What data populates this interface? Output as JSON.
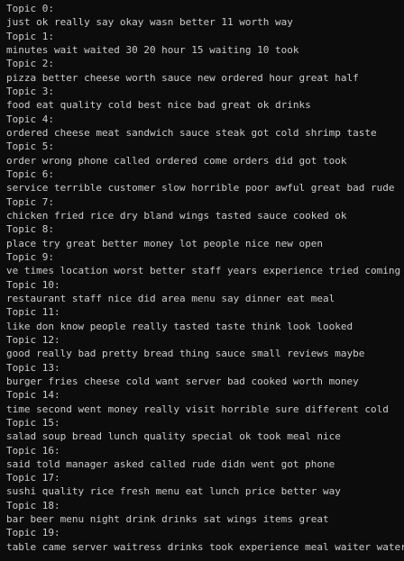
{
  "terminal": {
    "background": "#0c0c0c",
    "foreground": "#cccccc",
    "topics": [
      {
        "header": "Topic 0:",
        "words": "just ok really say okay wasn better 11 worth way"
      },
      {
        "header": "Topic 1:",
        "words": "minutes wait waited 30 20 hour 15 waiting 10 took"
      },
      {
        "header": "Topic 2:",
        "words": "pizza better cheese worth sauce new ordered hour great half"
      },
      {
        "header": "Topic 3:",
        "words": "food eat quality cold best nice bad great ok drinks"
      },
      {
        "header": "Topic 4:",
        "words": "ordered cheese meat sandwich sauce steak got cold shrimp taste"
      },
      {
        "header": "Topic 5:",
        "words": "order wrong phone called ordered come orders did got took"
      },
      {
        "header": "Topic 6:",
        "words": "service terrible customer slow horrible poor awful great bad rude"
      },
      {
        "header": "Topic 7:",
        "words": "chicken fried rice dry bland wings tasted sauce cooked ok"
      },
      {
        "header": "Topic 8:",
        "words": "place try great better money lot people nice new open"
      },
      {
        "header": "Topic 9:",
        "words": "ve times location worst better staff years experience tried coming"
      },
      {
        "header": "Topic 10:",
        "words": "restaurant staff nice did area menu say dinner eat meal"
      },
      {
        "header": "Topic 11:",
        "words": "like don know people really tasted taste think look looked"
      },
      {
        "header": "Topic 12:",
        "words": "good really bad pretty bread thing sauce small reviews maybe"
      },
      {
        "header": "Topic 13:",
        "words": "burger fries cheese cold want server bad cooked worth money"
      },
      {
        "header": "Topic 14:",
        "words": "time second went money really visit horrible sure different cold"
      },
      {
        "header": "Topic 15:",
        "words": "salad soup bread lunch quality special ok took meal nice"
      },
      {
        "header": "Topic 16:",
        "words": "said told manager asked called rude didn went got phone"
      },
      {
        "header": "Topic 17:",
        "words": "sushi quality rice fresh menu eat lunch price better way"
      },
      {
        "header": "Topic 18:",
        "words": "bar beer menu night drink drinks sat wings items great"
      },
      {
        "header": "Topic 19:",
        "words": "table came server waitress drinks took experience meal waiter water"
      }
    ]
  }
}
